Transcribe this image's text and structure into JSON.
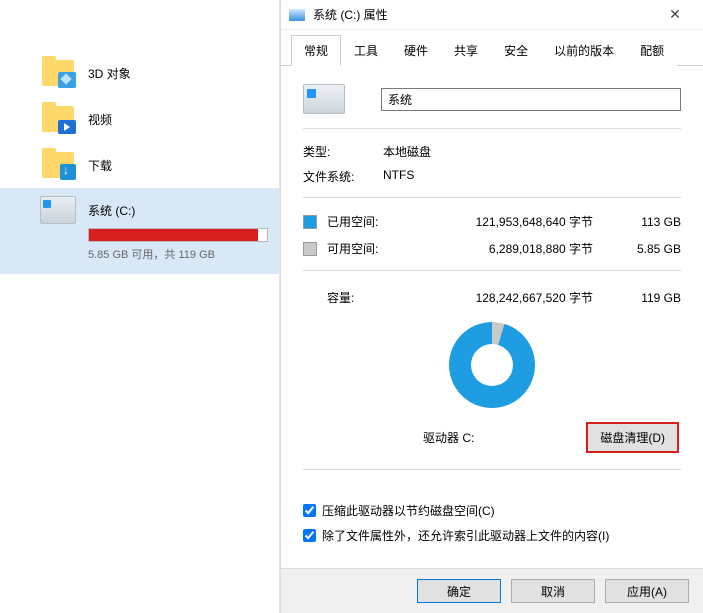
{
  "explorer": {
    "items": [
      {
        "label": "3D 对象",
        "kind": "threed"
      },
      {
        "label": "视频",
        "kind": "video"
      },
      {
        "label": "下载",
        "kind": "download"
      }
    ],
    "drive": {
      "label": "系统 (C:)",
      "subtext": "5.85 GB 可用，共 119 GB",
      "fill_percent": 95
    }
  },
  "dialog": {
    "title": "系统 (C:) 属性",
    "tabs": [
      "常规",
      "工具",
      "硬件",
      "共享",
      "安全",
      "以前的版本",
      "配额"
    ],
    "active_tab": 0,
    "name_value": "系统",
    "type_label": "类型:",
    "type_value": "本地磁盘",
    "fs_label": "文件系统:",
    "fs_value": "NTFS",
    "used_label": "已用空间:",
    "used_bytes": "121,953,648,640 字节",
    "used_size": "113 GB",
    "free_label": "可用空间:",
    "free_bytes": "6,289,018,880 字节",
    "free_size": "5.85 GB",
    "capacity_label": "容量:",
    "capacity_bytes": "128,242,667,520 字节",
    "capacity_size": "119 GB",
    "drive_letter": "驱动器 C:",
    "cleanup": "磁盘清理(D)",
    "check1": "压缩此驱动器以节约磁盘空间(C)",
    "check2": "除了文件属性外，还允许索引此驱动器上文件的内容(I)",
    "ok": "确定",
    "cancel": "取消",
    "apply": "应用(A)"
  }
}
